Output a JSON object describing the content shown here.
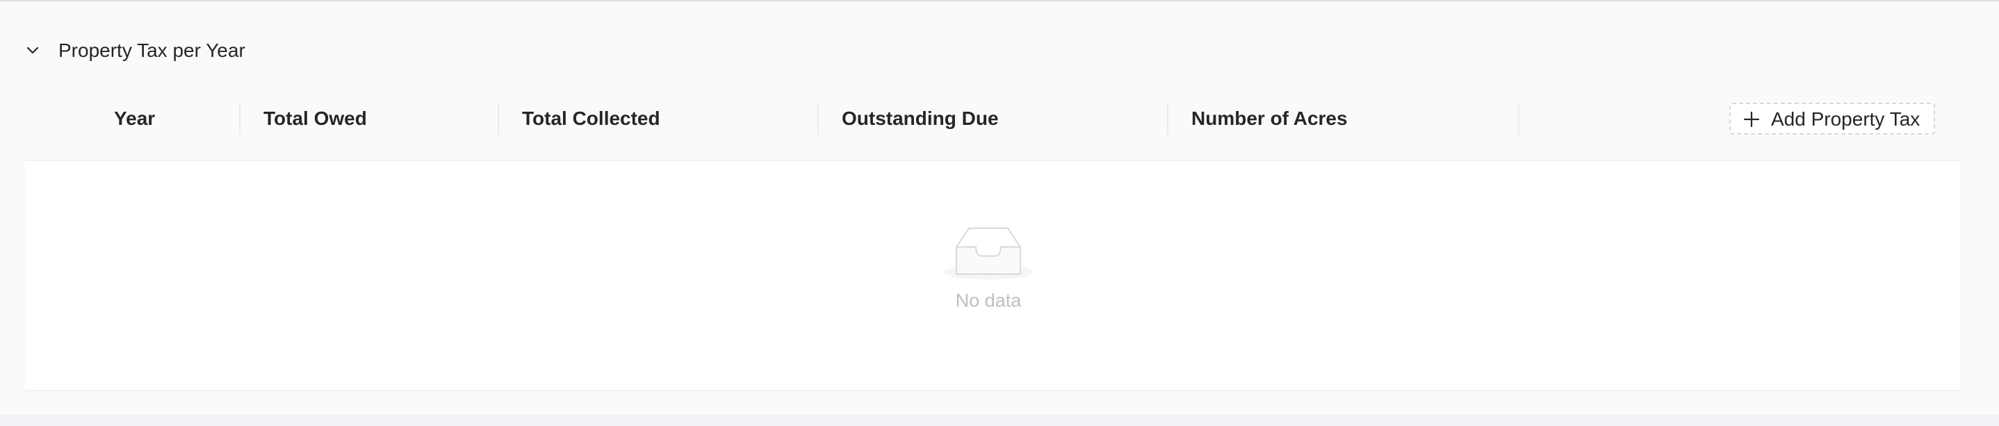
{
  "section": {
    "title": "Property Tax per Year"
  },
  "table": {
    "columns": [
      "Year",
      "Total Owed",
      "Total Collected",
      "Outstanding Due",
      "Number of Acres"
    ],
    "rows": [],
    "empty_text": "No data"
  },
  "actions": {
    "add_label": "Add Property Tax"
  },
  "icons": {
    "collapse": "chevron-down-icon",
    "add": "plus-icon",
    "empty": "empty-inbox-icon"
  },
  "colors": {
    "background": "#f0f2f5",
    "panel": "#fafafa",
    "text": "#262626",
    "muted": "#bfbfbf",
    "border": "#d9d9d9"
  }
}
